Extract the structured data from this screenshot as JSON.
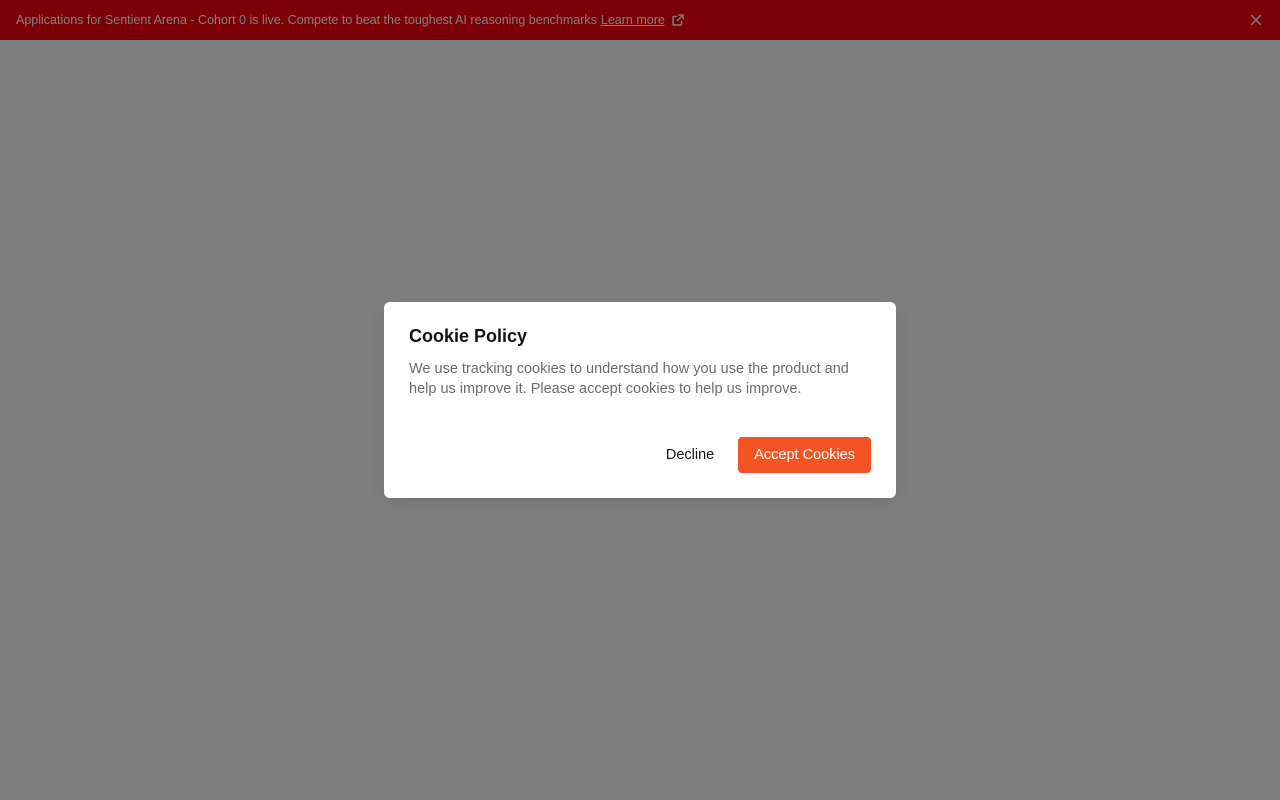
{
  "banner": {
    "text": "Applications for Sentient Arena - Cohort 0 is live. Compete to beat the toughest AI reasoning benchmarks",
    "link_label": "Learn more",
    "external_icon": "external-link-icon",
    "close_icon": "close-icon",
    "background_color": "#f4000a"
  },
  "cookie_dialog": {
    "title": "Cookie Policy",
    "body": "We use tracking cookies to understand how you use the product and help us improve it. Please accept cookies to help us improve.",
    "decline_label": "Decline",
    "accept_label": "Accept Cookies",
    "accent_color": "#f45424"
  }
}
